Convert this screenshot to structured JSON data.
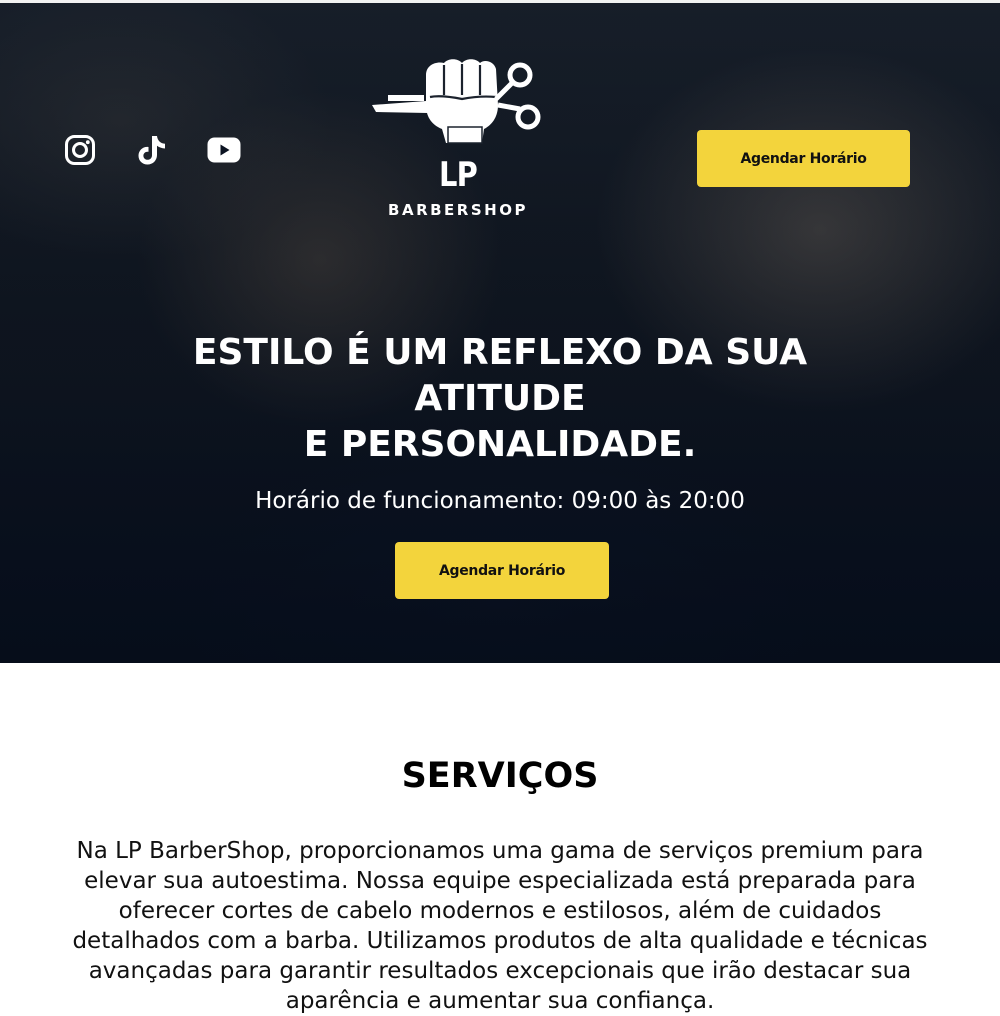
{
  "header": {
    "socials": [
      {
        "icon": "instagram-icon"
      },
      {
        "icon": "tiktok-icon"
      },
      {
        "icon": "youtube-icon"
      }
    ],
    "logo": {
      "initials": "LP",
      "subtitle": "BARBERSHOP"
    },
    "cta_label": "Agendar Horário"
  },
  "hero": {
    "headline_lines": [
      "ESTILO É UM REFLEXO DA SUA",
      "ATITUDE",
      "E PERSONALIDADE."
    ],
    "hours": "Horário de funcionamento: 09:00 às 20:00",
    "cta_label": "Agendar Horário"
  },
  "services": {
    "title": "SERVIÇOS",
    "text": "Na LP BarberShop, proporcionamos uma gama de serviços premium para elevar sua autoestima. Nossa equipe especializada está preparada para oferecer cortes de cabelo modernos e estilosos, além de cuidados detalhados com a barba. Utilizamos produtos de alta qualidade e técnicas avançadas para garantir resultados excepcionais que irão destacar sua aparência e aumentar sua confiança."
  },
  "colors": {
    "accent": "#f3d43c",
    "hero_dark": "#0b1322",
    "text_light": "#ffffff"
  }
}
